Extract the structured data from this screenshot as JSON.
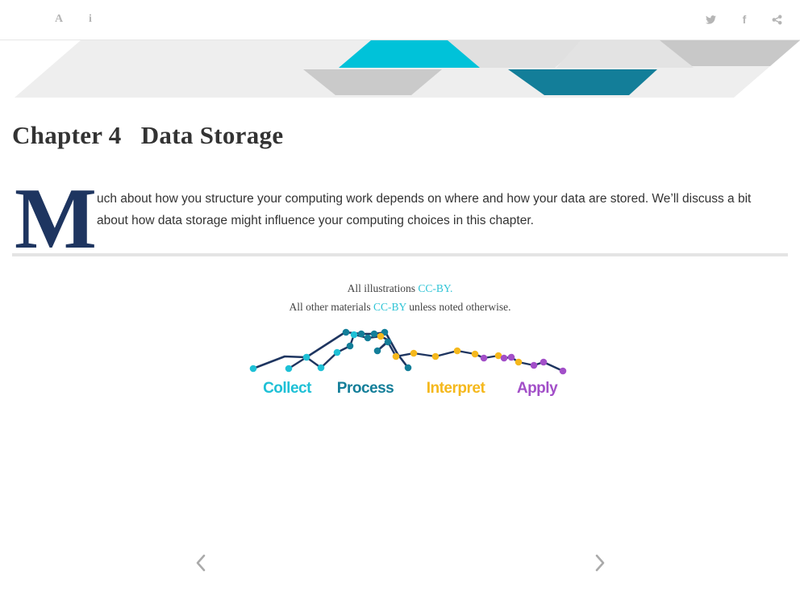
{
  "toolbar": {
    "left_buttons": [
      {
        "name": "font-settings-button",
        "icon": "font-icon"
      },
      {
        "name": "info-button",
        "icon": "info-icon"
      }
    ],
    "right_buttons": [
      {
        "name": "twitter-share-button",
        "icon": "twitter-icon"
      },
      {
        "name": "facebook-share-button",
        "icon": "facebook-icon"
      },
      {
        "name": "share-button",
        "icon": "share-icon"
      }
    ],
    "font_glyph": "A",
    "info_glyph": "i",
    "facebook_glyph": "f"
  },
  "chapter": {
    "title": "Chapter 4   Data Storage",
    "dropcap": "M",
    "intro": "uch about how you structure your computing work depends on where and how your data are stored. We’ll discuss a bit about how data storage might influence your computing choices in this chapter."
  },
  "credits": {
    "line1_prefix": "All illustrations ",
    "line1_link": "CC-BY.",
    "line2_prefix": "All other materials ",
    "line2_link": "CC-BY",
    "line2_suffix": " unless noted otherwise."
  },
  "workflow": {
    "stages": [
      {
        "label": "Collect",
        "color": "#1ec0d6"
      },
      {
        "label": "Process",
        "color": "#137e99"
      },
      {
        "label": "Interpret",
        "color": "#f5b81c"
      },
      {
        "label": "Apply",
        "color": "#a24fc8"
      }
    ],
    "line_color": "#1e3560"
  },
  "navigation": {
    "prev_icon": "chevron-left-icon",
    "next_icon": "chevron-right-icon"
  },
  "colors": {
    "accent": "#2ec4d6",
    "dropcap": "#1e3560",
    "banner_teal": "#00c2d9",
    "banner_blue": "#137e99",
    "banner_gray": "#cfcfcf"
  }
}
